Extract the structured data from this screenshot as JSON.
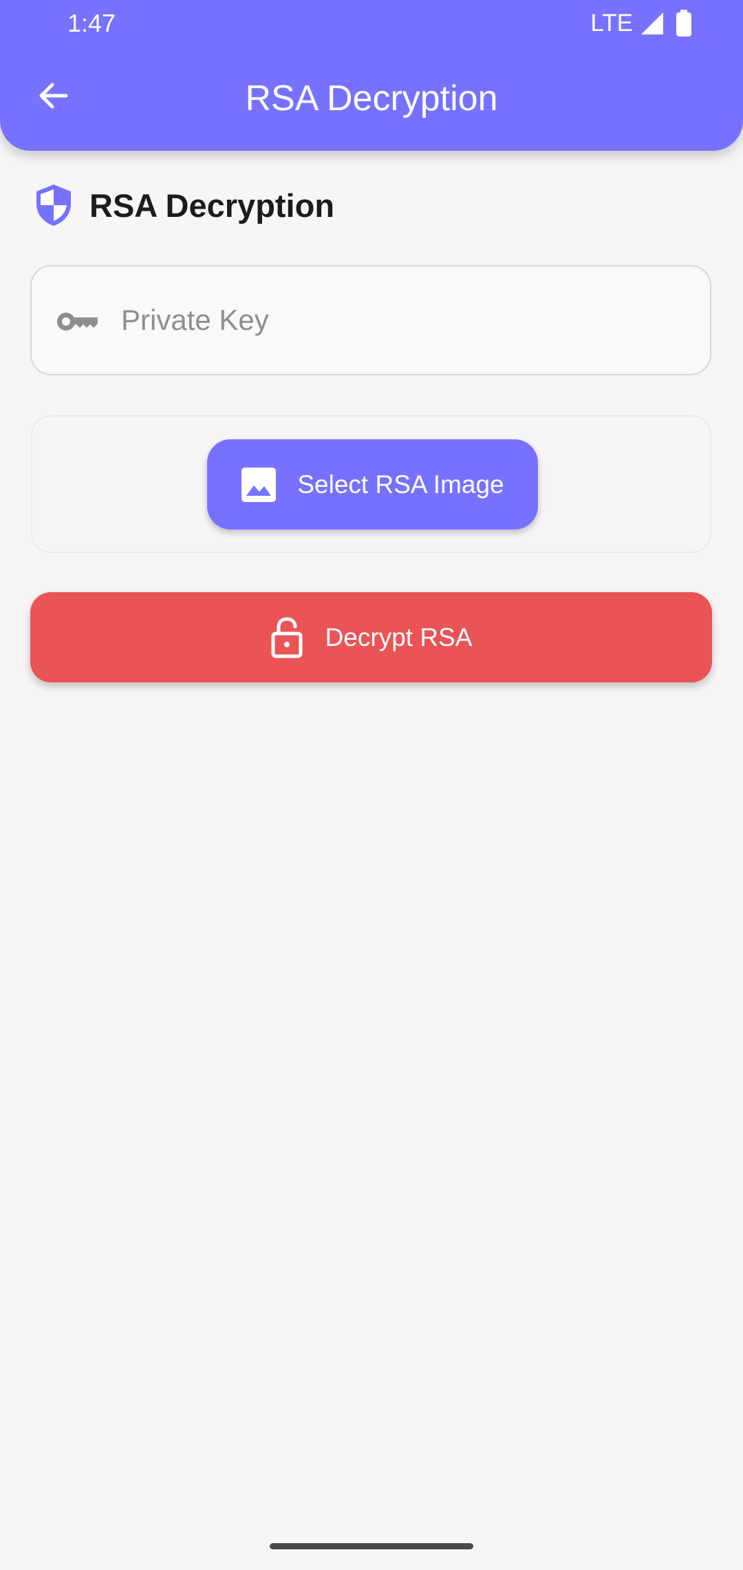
{
  "status_bar": {
    "time": "1:47",
    "network": "LTE",
    "icons": [
      "signal-icon",
      "battery-icon"
    ]
  },
  "app_bar": {
    "title": "RSA Decryption",
    "back_icon": "arrow-back-icon"
  },
  "section": {
    "title": "RSA Decryption",
    "icon": "shield-icon"
  },
  "private_key_field": {
    "placeholder": "Private Key",
    "value": "",
    "icon": "key-icon"
  },
  "select_image_button": {
    "label": "Select RSA Image",
    "icon": "image-icon"
  },
  "decrypt_button": {
    "label": "Decrypt RSA",
    "icon": "lock-open-icon"
  },
  "colors": {
    "primary": "#7672ff",
    "danger": "#ea5456",
    "background": "#f8f5f7"
  }
}
